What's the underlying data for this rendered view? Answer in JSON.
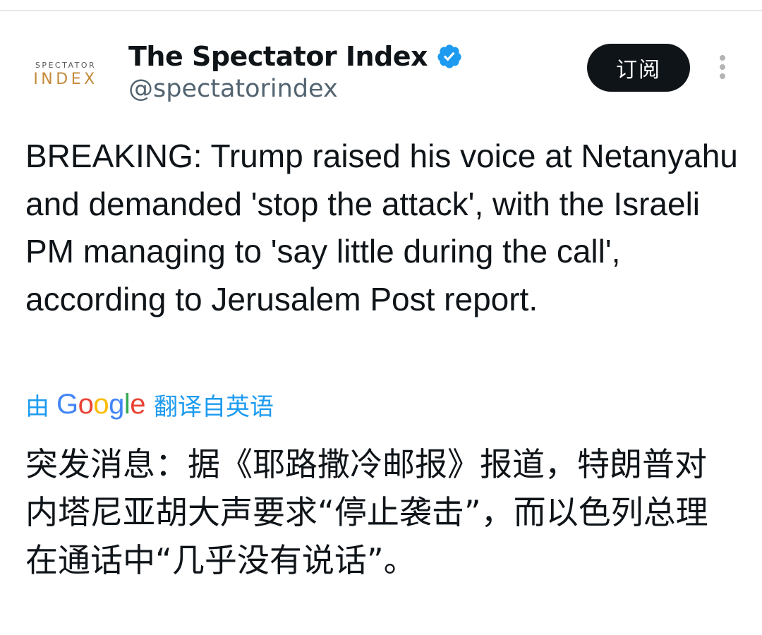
{
  "account": {
    "avatar_line1": "SPECTATOR",
    "avatar_line2": "INDEX",
    "display_name": "The Spectator Index",
    "handle": "@spectatorindex",
    "verified": true,
    "verified_color": "#1d9bf0"
  },
  "actions": {
    "subscribe_label": "订阅",
    "more_icon": "more-vertical-icon"
  },
  "tweet": {
    "text": "BREAKING: Trump raised his voice at Netanyahu and demanded 'stop the attack', with the Israeli PM managing to 'say little during the call', according to Jerusalem Post report."
  },
  "translation": {
    "by_label": "由",
    "provider": "Google",
    "from_label": "翻译自英语",
    "text": "突发消息：据《耶路撒冷邮报》报道，特朗普对内塔尼亚胡大声要求“停止袭击”，而以色列总理在通话中“几乎没有说话”。"
  },
  "colors": {
    "accent": "#1d9bf0",
    "text": "#0f1419",
    "secondary_text": "#536471",
    "avatar_brand": "#c58a3c"
  }
}
